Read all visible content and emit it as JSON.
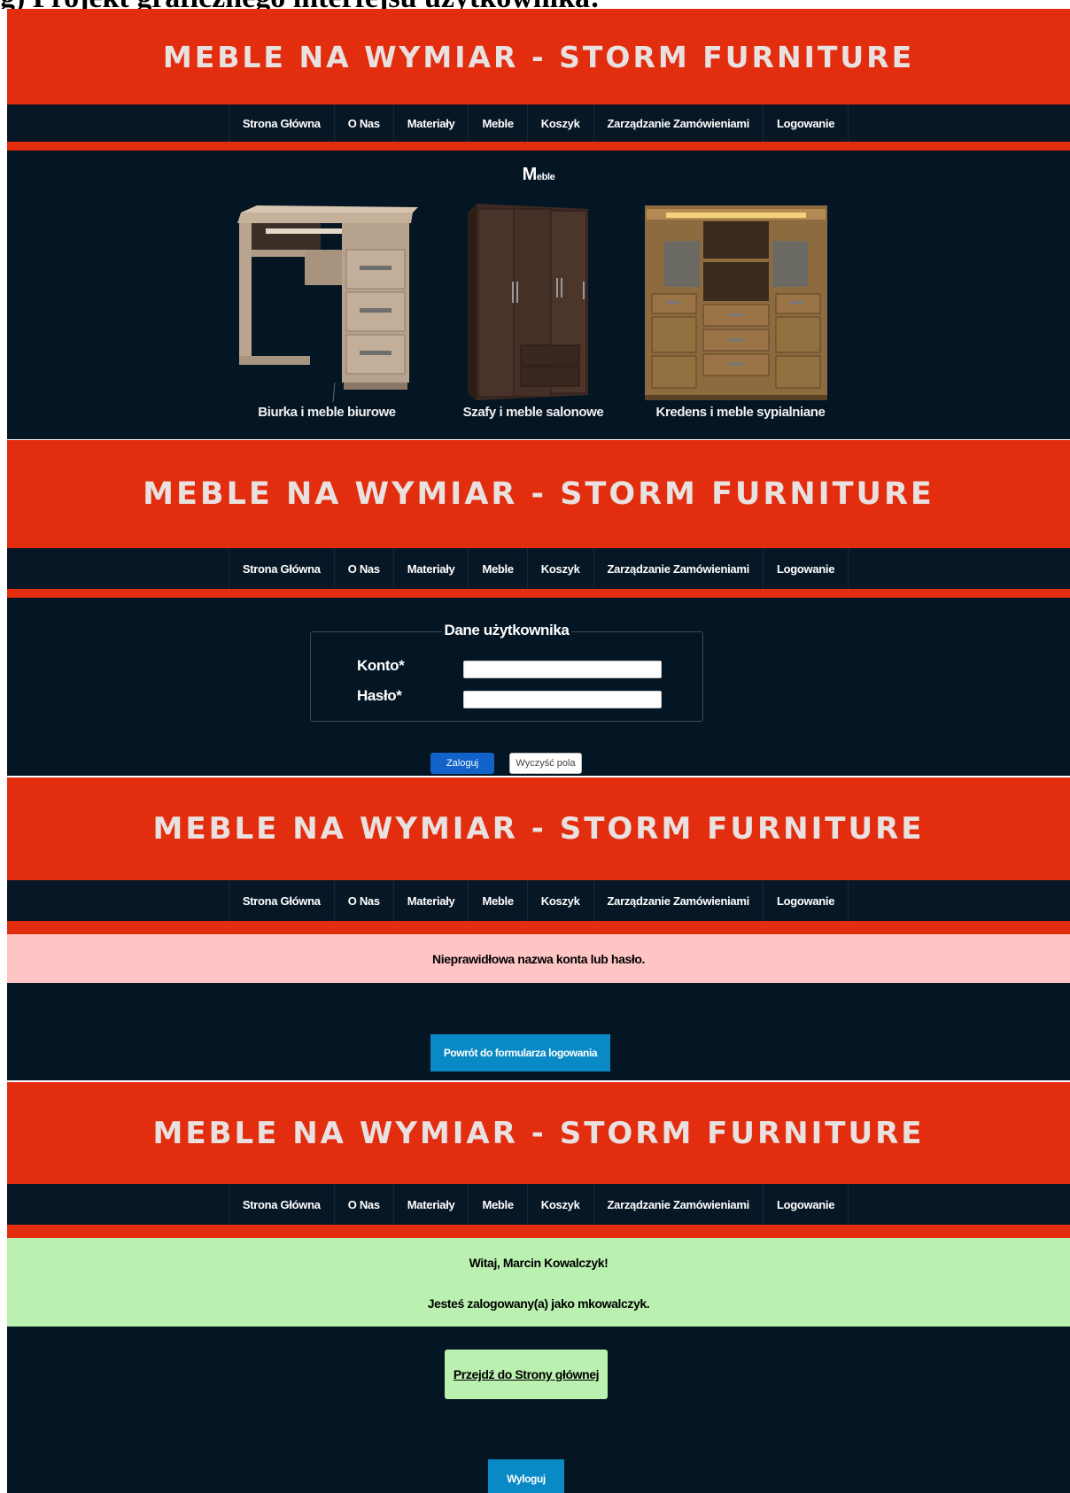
{
  "document": {
    "heading": "g) Projekt graficznego interfejsu użytkownika:"
  },
  "site": {
    "header_title": "MEBLE NA WYMIAR - STORM FURNITURE",
    "nav": [
      "Strona Główna",
      "O Nas",
      "Materiały",
      "Meble",
      "Koszyk",
      "Zarządzanie Zamówieniami",
      "Logowanie"
    ]
  },
  "colors": {
    "header": "#e32d0f",
    "page_bg": "#041523",
    "error_bg": "#ffc4c4",
    "success_bg": "#baf0b0",
    "primary": "#1162c9",
    "info": "#098ac5"
  },
  "furniture_page": {
    "title_big": "M",
    "title_small": "eble",
    "items": [
      {
        "caption": "Biurka i meble biurowe",
        "icon": "desk-image"
      },
      {
        "caption": "Szafy i meble salonowe",
        "icon": "wardrobe-image"
      },
      {
        "caption": "Kredens i meble sypialniane",
        "icon": "sideboard-image"
      }
    ]
  },
  "login_page": {
    "legend": "Dane użytkownika",
    "account_label": "Konto*",
    "password_label": "Hasło*",
    "account_value": "",
    "password_value": "",
    "login_button": "Zaloguj",
    "clear_button": "Wyczyść pola"
  },
  "error_page": {
    "message": "Nieprawidłowa nazwa konta lub hasło.",
    "back_button": "Powrót do formularza logowania"
  },
  "success_page": {
    "greeting": "Witaj, Marcin Kowalczyk!",
    "status": "Jesteś zalogowany(a) jako mkowalczyk.",
    "home_link": "Przejdź do Strony głównej",
    "logout_button": "Wyloguj"
  }
}
